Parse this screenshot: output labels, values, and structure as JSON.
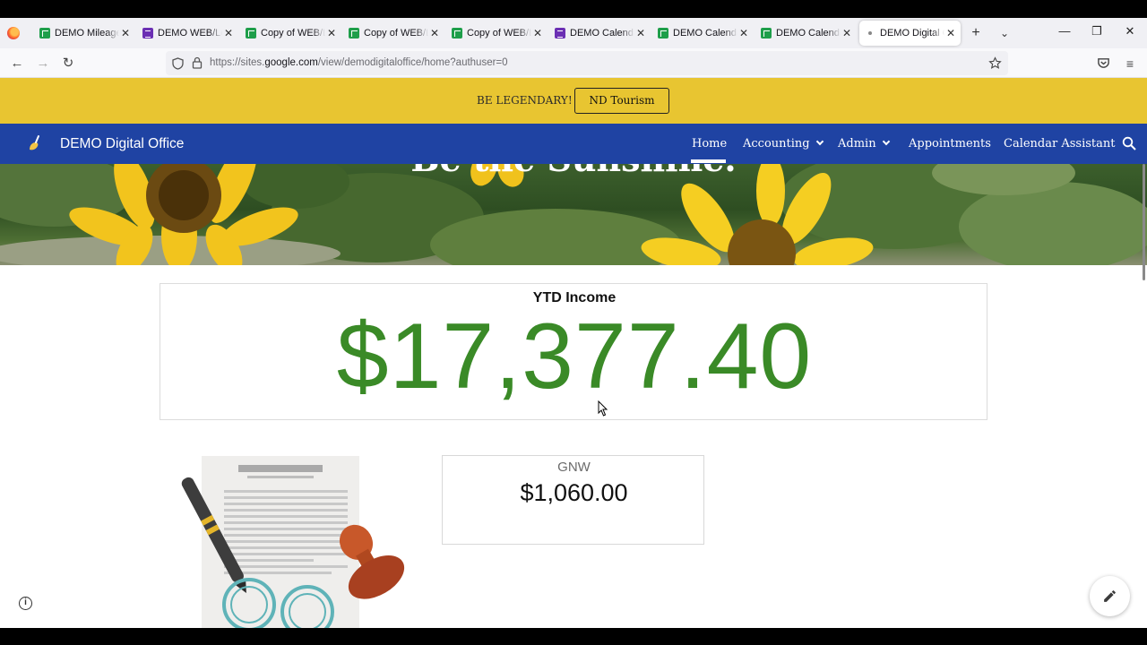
{
  "browser": {
    "tabs": [
      {
        "title": "DEMO Mileage",
        "icon": "sheets-icon"
      },
      {
        "title": "DEMO WEB/Log",
        "icon": "forms-icon"
      },
      {
        "title": "Copy of WEB/Lo",
        "icon": "sheets-icon"
      },
      {
        "title": "Copy of WEB/Lo",
        "icon": "sheets-icon"
      },
      {
        "title": "Copy of WEB/Lo",
        "icon": "sheets-icon"
      },
      {
        "title": "DEMO Calendar",
        "icon": "forms-icon"
      },
      {
        "title": "DEMO Calendar",
        "icon": "sheets-icon"
      },
      {
        "title": "DEMO Calendar",
        "icon": "sheets-icon"
      },
      {
        "title": "DEMO Digital Of",
        "icon": "sites-icon",
        "active": true
      }
    ],
    "url_prefix": "https://sites.",
    "url_domain": "google.com",
    "url_path": "/view/demodigitaloffice/home?authuser=0"
  },
  "announcement": {
    "text": "BE LEGENDARY!",
    "button_label": "ND Tourism"
  },
  "site": {
    "name": "DEMO Digital Office",
    "nav": {
      "home": "Home",
      "accounting": "Accounting",
      "admin": "Admin",
      "appointments": "Appointments",
      "calendar_assistant": "Calendar Assistant"
    }
  },
  "hero": {
    "title": "Be the Sunshine."
  },
  "income": {
    "label": "YTD Income",
    "value": "$17,377.40"
  },
  "gnw": {
    "label": "GNW",
    "value": "$1,060.00"
  },
  "colors": {
    "announcement_bg": "#e8c531",
    "nav_bg": "#1f43a3",
    "income_green": "#3a8a27"
  }
}
